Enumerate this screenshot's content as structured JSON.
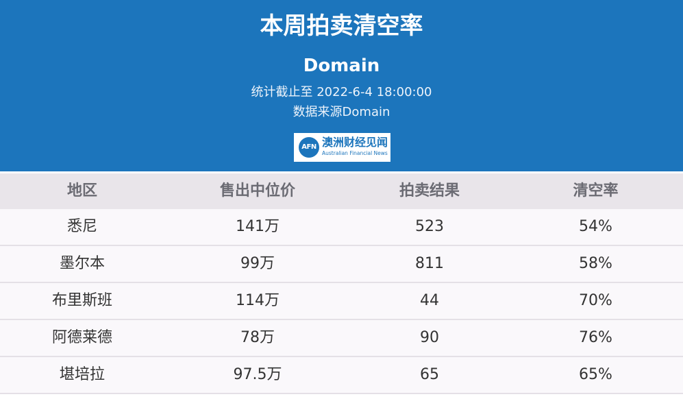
{
  "header": {
    "title": "本周拍卖清空率",
    "subtitle": "Domain",
    "stat_cutoff": "统计截止至 2022-6-4 18:00:00",
    "source": "数据来源Domain",
    "logo": {
      "mark": "AFN",
      "cn": "澳洲财经见闻",
      "en": "Australian Financial News"
    }
  },
  "chart_data": {
    "type": "table",
    "columns": [
      "地区",
      "售出中位价",
      "拍卖结果",
      "清空率"
    ],
    "rows": [
      [
        "悉尼",
        "141万",
        "523",
        "54%"
      ],
      [
        "墨尔本",
        "99万",
        "811",
        "58%"
      ],
      [
        "布里斯班",
        "114万",
        "44",
        "70%"
      ],
      [
        "阿德莱德",
        "78万",
        "90",
        "76%"
      ],
      [
        "堪培拉",
        "97.5万",
        "65",
        "65%"
      ]
    ]
  },
  "colors": {
    "header_bg": "#1c75bc",
    "table_head_bg": "#e9e5ea",
    "row_bg": "#faf8fb"
  }
}
